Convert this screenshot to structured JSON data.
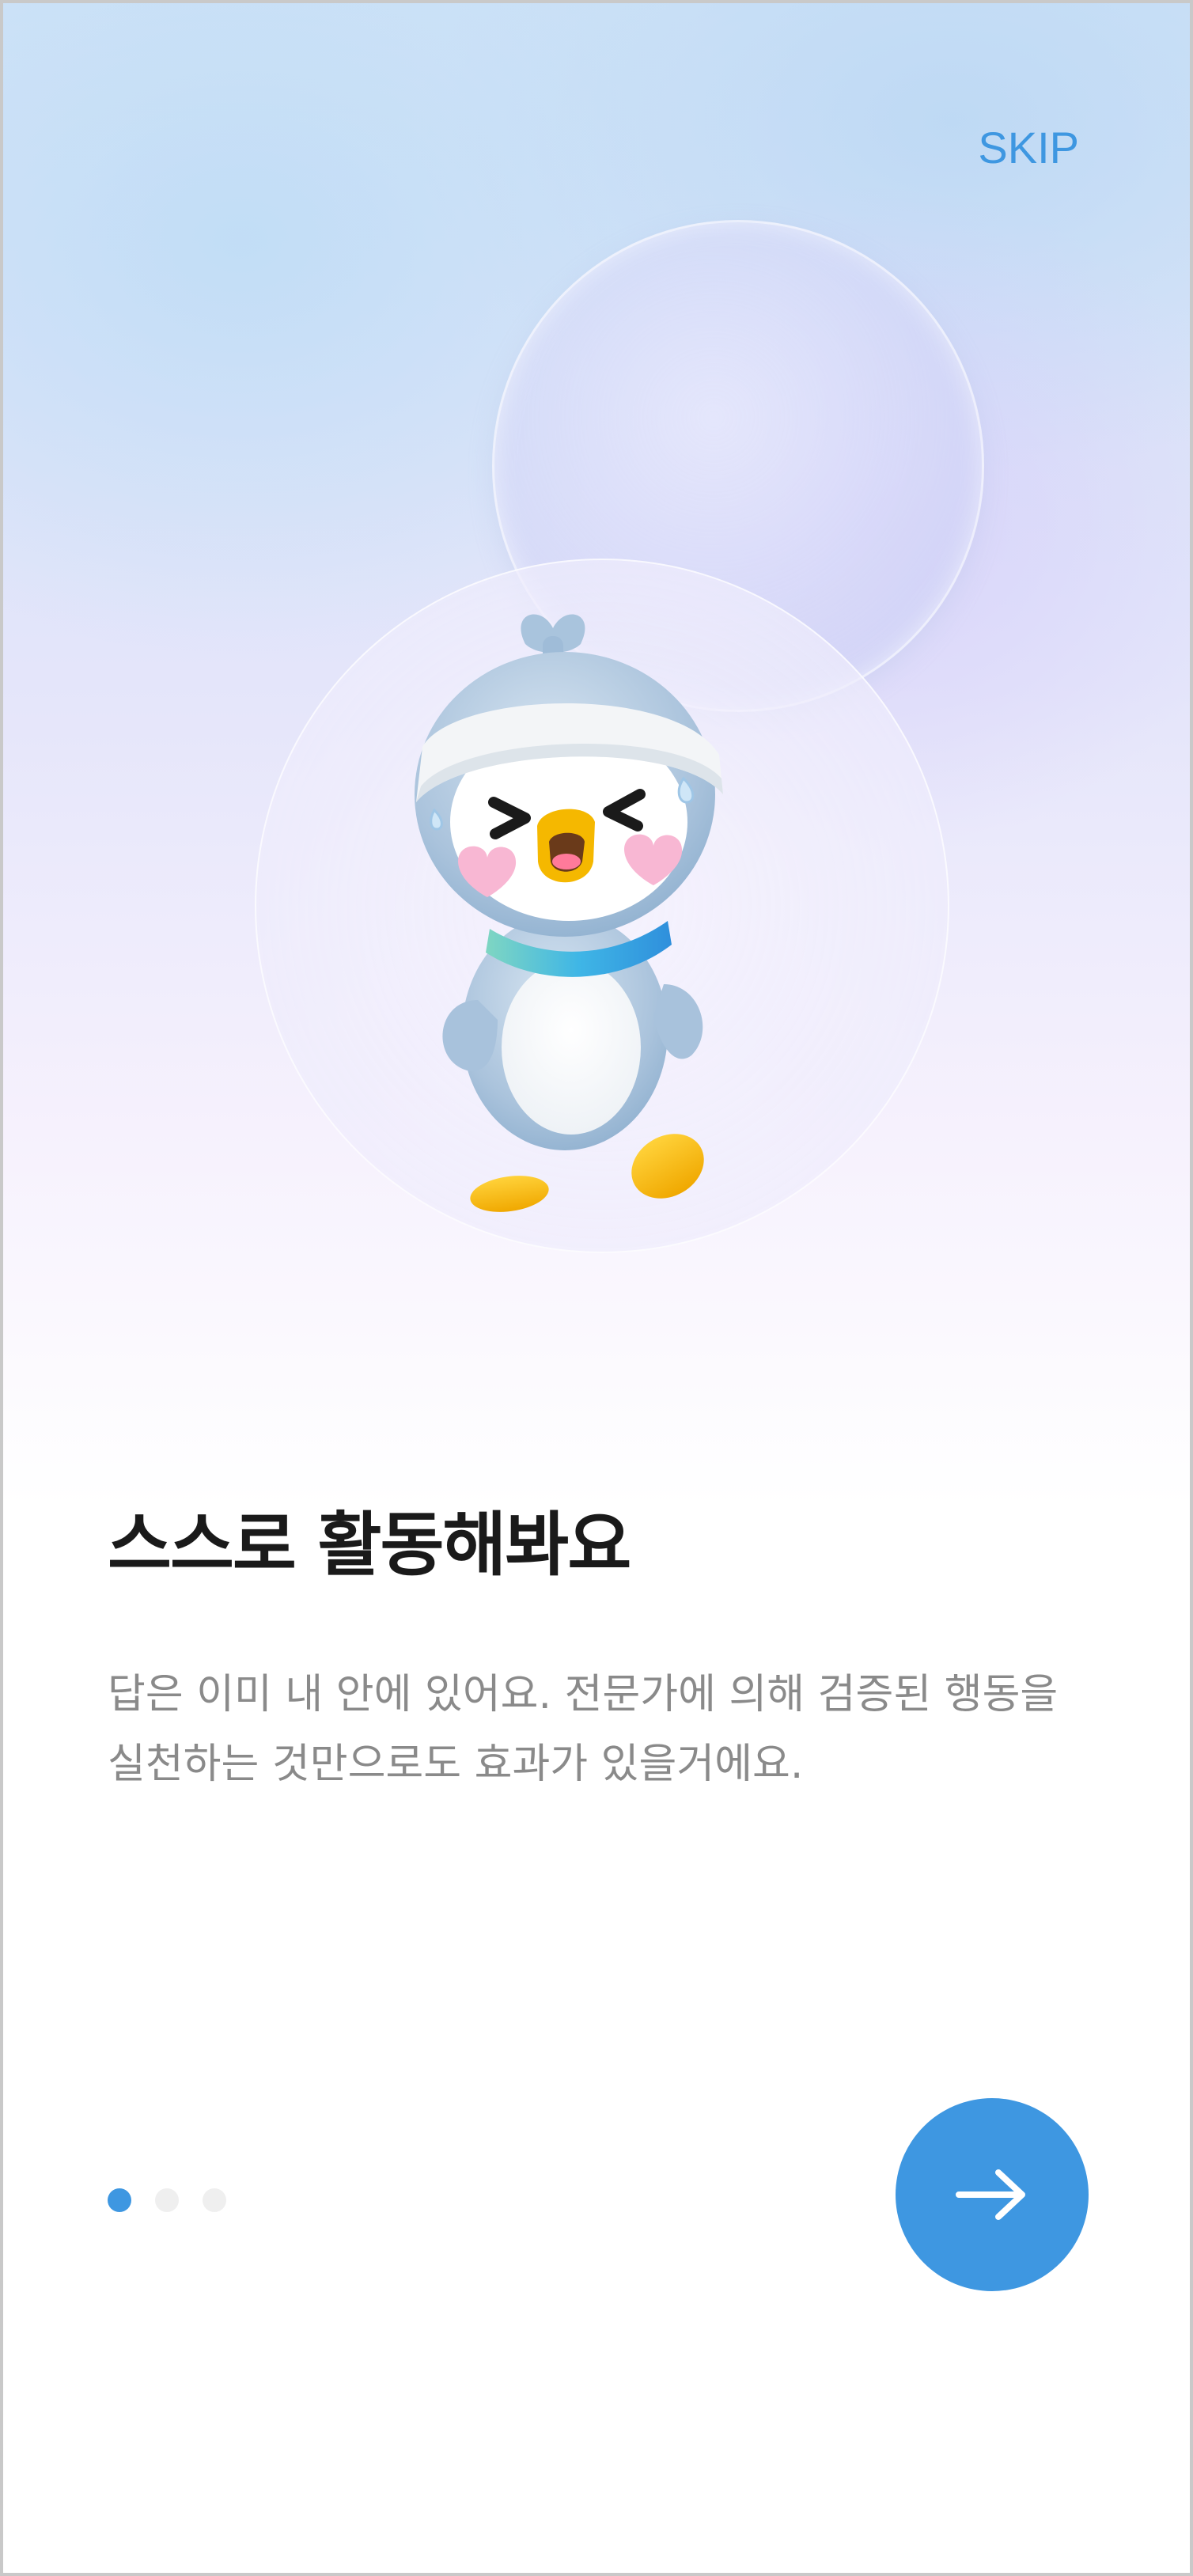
{
  "header": {
    "skip_label": "SKIP"
  },
  "onboarding": {
    "title": "스스로 활동해봐요",
    "description": "답은 이미 내 안에 있어요. 전문가에 의해 검증된 행동을 실천하는 것만으로도 효과가 있을거에요.",
    "page_count": 3,
    "current_page": 1
  },
  "icons": {
    "next": "arrow-right-icon",
    "mascot": "penguin-mascot-illustration"
  },
  "colors": {
    "accent": "#3e97e1",
    "title": "#1a1a1a",
    "body": "#8a8a8a",
    "dot_inactive": "#efefef"
  }
}
